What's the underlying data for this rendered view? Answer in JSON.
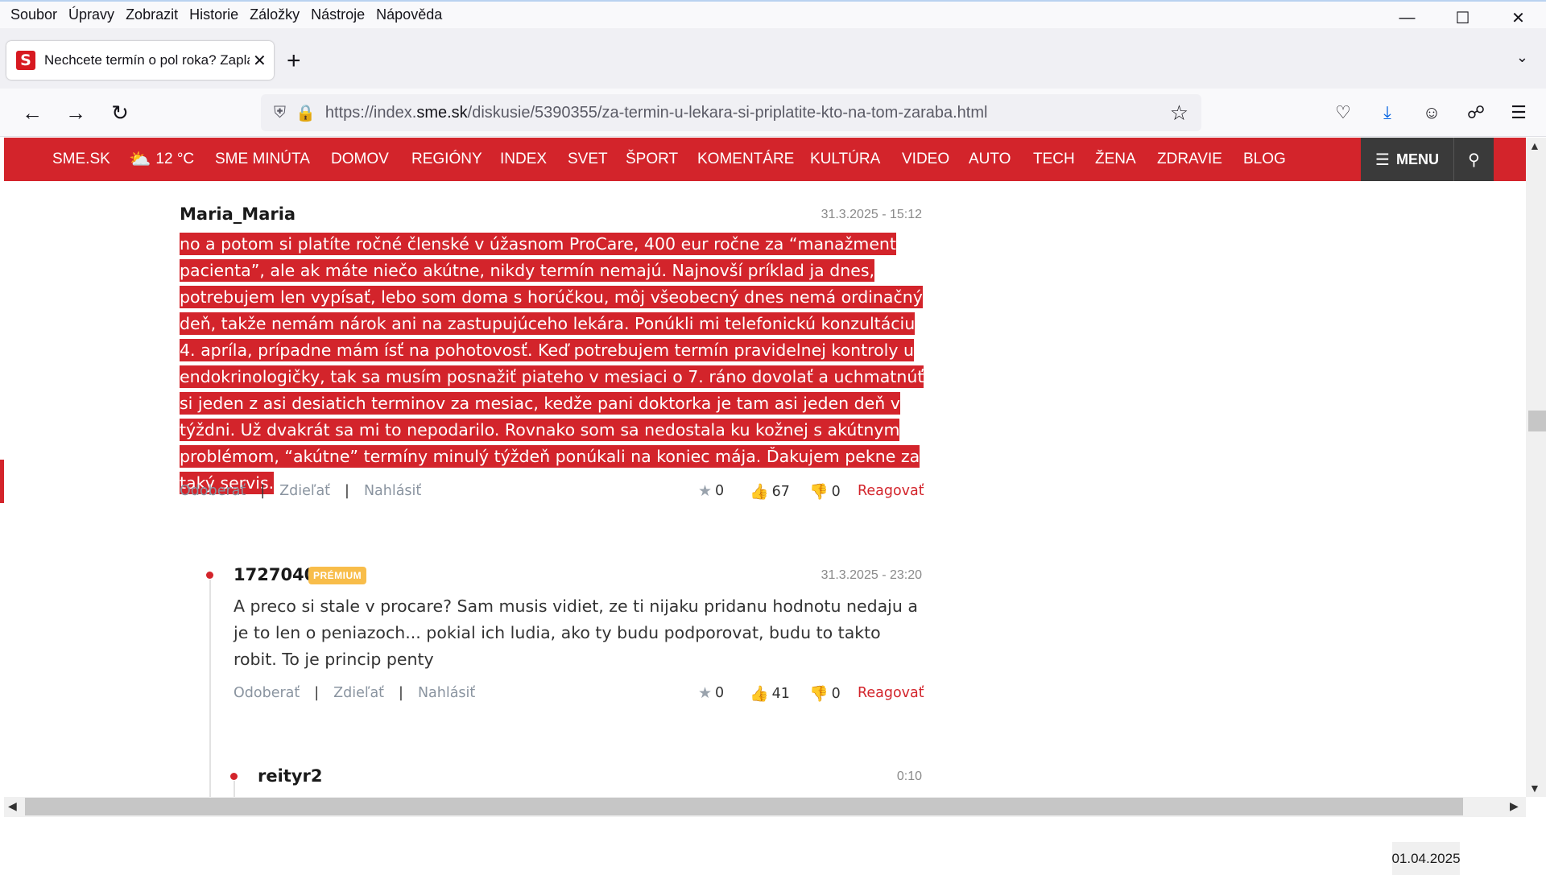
{
  "menubar": [
    "Soubor",
    "Úpravy",
    "Zobrazit",
    "Historie",
    "Záložky",
    "Nástroje",
    "Nápověda"
  ],
  "tab": {
    "title": "Nechcete termín o pol roka? Zaplaťte",
    "favicon": "S"
  },
  "url": {
    "prefix": "https://index.",
    "host": "sme.sk",
    "path": "/diskusie/5390355/za-termin-u-lekara-si-priplatite-kto-na-tom-zaraba.html"
  },
  "sitenav": {
    "logo": "SME.SK",
    "weather": "12 °C",
    "items": [
      "SME MINÚTA",
      "DOMOV",
      "REGIÓNY",
      "INDEX",
      "SVET",
      "ŠPORT",
      "KOMENTÁRE",
      "KULTÚRA",
      "VIDEO",
      "AUTO",
      "TECH",
      "ŽENA",
      "ZDRAVIE",
      "BLOG"
    ],
    "menu_label": "MENU"
  },
  "comments": [
    {
      "author": "Maria_Maria",
      "date": "31.3.2025 - 15:12",
      "text": "no a potom si platíte ročné členské v úžasnom ProCare, 400 eur ročne za “manažment pacienta”, ale ak máte niečo akútne, nikdy termín nemajú. Najnovší príklad ja dnes, potrebujem len vypísať, lebo som doma s horúčkou, môj všeobecný dnes nemá ordinačný deň, takže nemám nárok ani na zastupujúceho lekára. Ponúkli mi telefonickú konzultáciu 4. apríla, prípadne mám ísť na pohotovosť. Keď potrebujem termín pravidelnej kontroly u endokrinologičky, tak sa musím posnažiť piateho v mesiaci o 7. ráno dovolať a uchmatnúť si jeden z asi desiatich terminov za mesiac, kedže pani doktorka je tam asi jeden deň v týždni. Už dvakrát sa mi to nepodarilo. Rovnako som sa nedostala ku kožnej s akútnym problémom, “akútne” termíny minulý týždeň ponúkali na koniec mája. Ďakujem pekne za taký servis.",
      "actions": [
        "Odoberať",
        "Zdieľať",
        "Nahlásiť"
      ],
      "stars": "0",
      "likes": "67",
      "dislikes": "0",
      "reply": "Reagovať"
    },
    {
      "author": "1727040",
      "badge": "PRÉMIUM",
      "date": "31.3.2025 - 23:20",
      "text": "A preco si stale v procare? Sam musis vidiet, ze ti nijaku pridanu hodnotu nedaju a je to len o peniazoch... pokial ich ludia, ako ty budu podporovat, budu to takto robit. To je princip penty",
      "actions": [
        "Odoberať",
        "Zdieľať",
        "Nahlásiť"
      ],
      "stars": "0",
      "likes": "41",
      "dislikes": "0",
      "reply": "Reagovať"
    },
    {
      "author": "reityr2",
      "date": "0:10"
    }
  ],
  "taskbar_date": "01.04.2025",
  "colors": {
    "brand_red": "#d3242b",
    "premium": "#f8bd4a"
  }
}
